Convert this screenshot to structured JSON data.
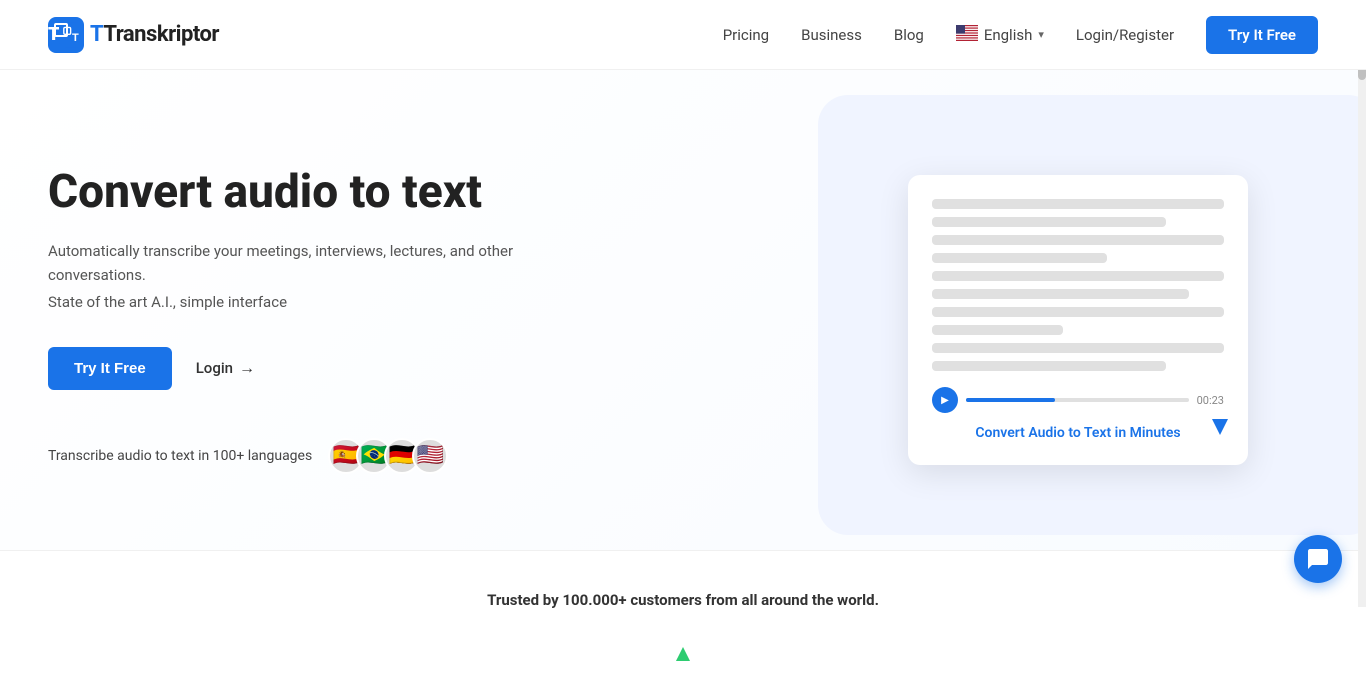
{
  "brand": {
    "name": "Transkriptor",
    "logo_letter": "T"
  },
  "nav": {
    "pricing": "Pricing",
    "business": "Business",
    "blog": "Blog",
    "language": "English",
    "login_register": "Login/Register",
    "try_free": "Try It Free"
  },
  "hero": {
    "title": "Convert audio to text",
    "subtitle1": "Automatically transcribe your meetings, interviews, lectures, and other conversations.",
    "subtitle2": "State of the art A.I., simple interface",
    "btn_try": "Try It Free",
    "btn_login": "Login",
    "languages_text": "Transcribe audio to text in 100+ languages",
    "illustration_label": "Convert Audio to Text in Minutes"
  },
  "trusted": {
    "text": "Trusted by 100.000+ customers from all around the world."
  },
  "flags": [
    "🇪🇸",
    "🇧🇷",
    "🇩🇪",
    "🇺🇸"
  ],
  "text_lines": [
    {
      "width": "100%"
    },
    {
      "width": "85%"
    },
    {
      "width": "100%"
    },
    {
      "width": "70%"
    },
    {
      "width": "100%"
    },
    {
      "width": "90%"
    },
    {
      "width": "100%"
    },
    {
      "width": "60%"
    },
    {
      "width": "100%"
    },
    {
      "width": "75%"
    }
  ]
}
